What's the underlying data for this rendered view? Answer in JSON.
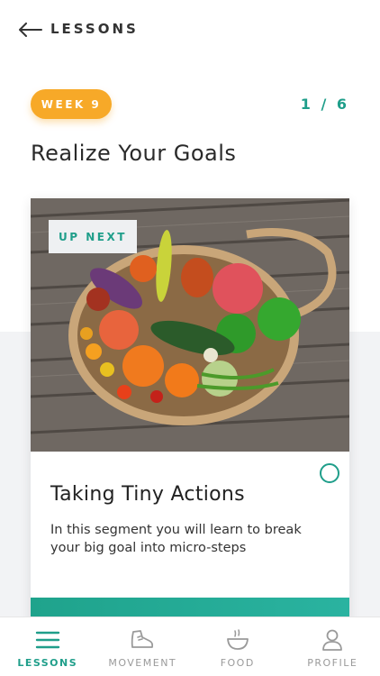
{
  "header": {
    "back_label": "LESSONS"
  },
  "week_badge": "WEEK 9",
  "progress_text": "1 / 6",
  "title": "Realize Your Goals",
  "card": {
    "badge": "UP NEXT",
    "title": "Taking Tiny Actions",
    "description": "In this segment you will learn to break your big goal into micro-steps"
  },
  "tabs": [
    {
      "label": "LESSONS",
      "icon": "menu-icon",
      "active": true
    },
    {
      "label": "MOVEMENT",
      "icon": "shoe-icon",
      "active": false
    },
    {
      "label": "FOOD",
      "icon": "bowl-icon",
      "active": false
    },
    {
      "label": "PROFILE",
      "icon": "person-icon",
      "active": false
    }
  ],
  "colors": {
    "accent": "#1f9e8a",
    "badge": "#f7a928"
  }
}
